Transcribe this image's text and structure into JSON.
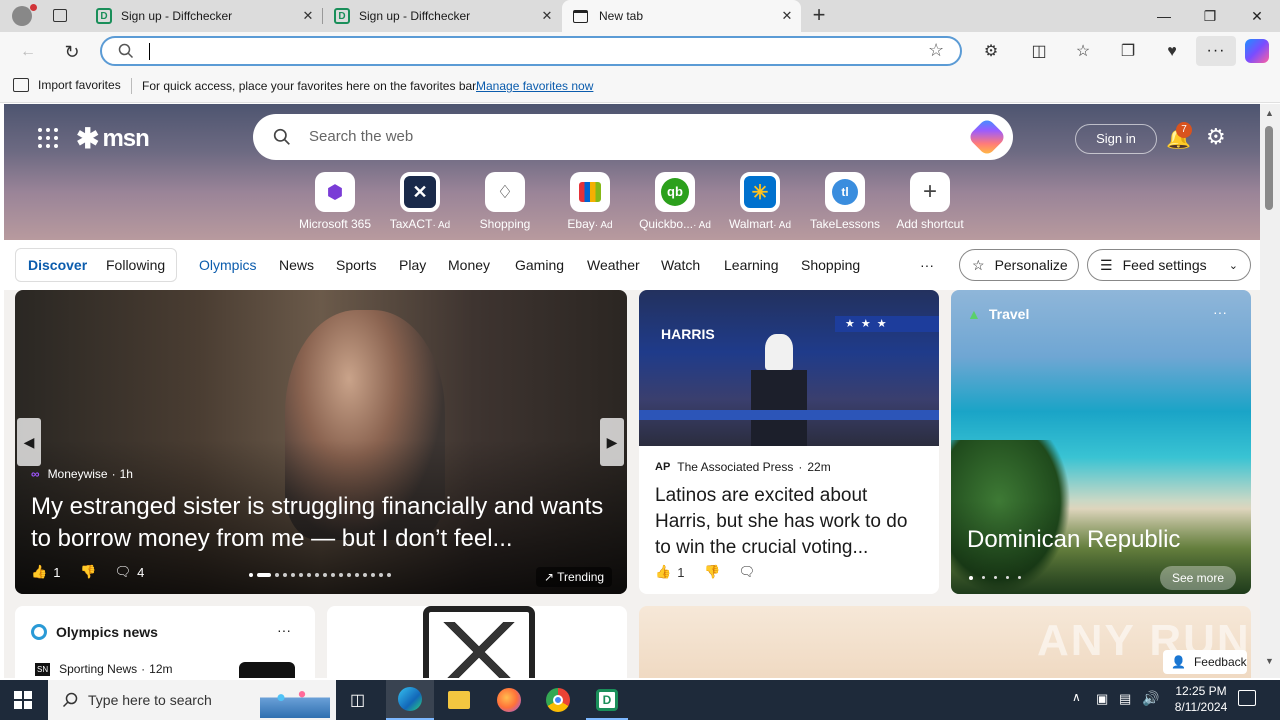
{
  "tabs": [
    {
      "title": "Sign up - Diffchecker",
      "icon": "diffchecker-icon"
    },
    {
      "title": "Sign up - Diffchecker",
      "icon": "diffchecker-icon"
    },
    {
      "title": "New tab",
      "icon": "new-tab-icon"
    }
  ],
  "favorites_bar": {
    "import_label": "Import favorites",
    "message": "For quick access, place your favorites here on the favorites bar.",
    "manage_link": "Manage favorites now"
  },
  "msn": {
    "logo": "msn",
    "search_placeholder": "Search the web",
    "sign_in": "Sign in",
    "notification_count": "7",
    "shortcuts": [
      {
        "label": "Microsoft 365",
        "ad": "",
        "icon": "m365-icon"
      },
      {
        "label": "TaxACT",
        "ad": "· Ad",
        "icon": "taxact-icon"
      },
      {
        "label": "Shopping",
        "ad": "",
        "icon": "shopping-tag-icon"
      },
      {
        "label": "Ebay",
        "ad": "· Ad",
        "icon": "ebay-icon"
      },
      {
        "label": "Quickbo...",
        "ad": "· Ad",
        "icon": "quickbooks-icon"
      },
      {
        "label": "Walmart",
        "ad": "· Ad",
        "icon": "walmart-icon"
      },
      {
        "label": "TakeLessons",
        "ad": "",
        "icon": "takelessons-icon"
      },
      {
        "label": "Add shortcut",
        "ad": "",
        "icon": "plus-icon"
      }
    ],
    "nav": {
      "discover": "Discover",
      "following": "Following",
      "items": [
        "Olympics",
        "News",
        "Sports",
        "Play",
        "Money",
        "Gaming",
        "Weather",
        "Watch",
        "Learning",
        "Shopping"
      ],
      "more": "···",
      "personalize": "Personalize",
      "feed_settings": "Feed settings"
    },
    "main_story": {
      "source": "Moneywise",
      "time": "1h",
      "headline": "My estranged sister is struggling financially and wants to borrow money from me — but I don’t feel...",
      "likes": "1",
      "comments": "4",
      "trending": "Trending"
    },
    "story2": {
      "source": "The Associated Press",
      "source_badge": "AP",
      "time": "22m",
      "headline": "Latinos are excited about Harris, but she has work to do to win the crucial voting...",
      "likes": "1",
      "podium_sign": "HARRIS"
    },
    "travel": {
      "category": "Travel",
      "title": "Dominican Republic",
      "see_more": "See more"
    },
    "olympics": {
      "title": "Olympics news",
      "source": "Sporting News",
      "source_badge": "SN",
      "time": "12m"
    },
    "feedback": "Feedback",
    "watermark": "ANY RUN"
  },
  "taskbar": {
    "search_placeholder": "Type here to search",
    "time": "12:25 PM",
    "date": "8/11/2024"
  }
}
